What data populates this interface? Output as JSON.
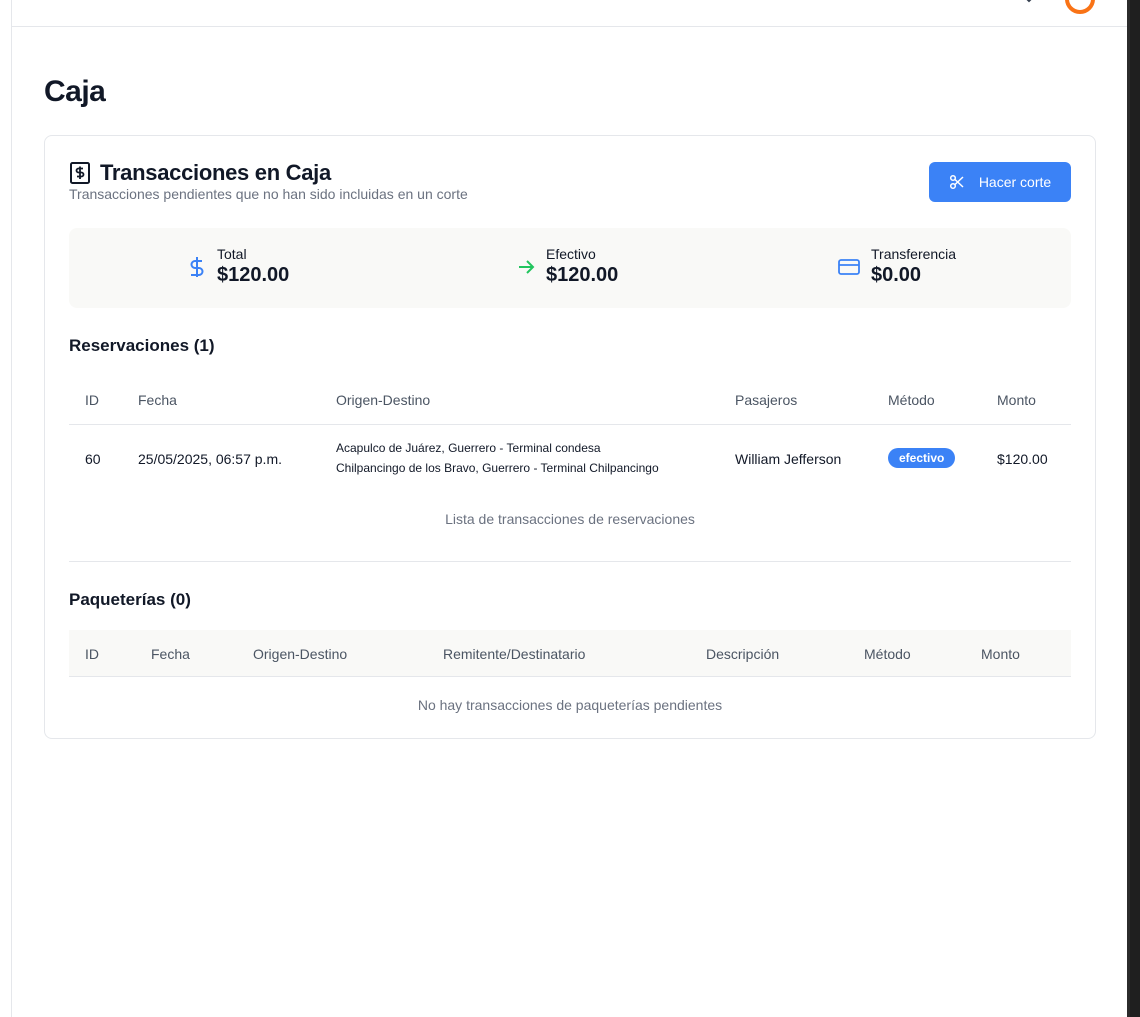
{
  "page": {
    "title": "Caja"
  },
  "card": {
    "title": "Transacciones en Caja",
    "subtitle": "Transacciones pendientes que no han sido incluidas en un corte",
    "button_label": "Hacer corte"
  },
  "summary": {
    "total": {
      "label": "Total",
      "value": "$120.00",
      "icon": "dollar-icon"
    },
    "cash": {
      "label": "Efectivo",
      "value": "$120.00",
      "icon": "arrow-right-icon"
    },
    "transfer": {
      "label": "Transferencia",
      "value": "$0.00",
      "icon": "credit-card-icon"
    }
  },
  "reservations": {
    "title": "Reservaciones (1)",
    "columns": [
      "ID",
      "Fecha",
      "Origen-Destino",
      "Pasajeros",
      "Método",
      "Monto"
    ],
    "rows": [
      {
        "id": "60",
        "date": "25/05/2025, 06:57 p.m.",
        "origin": "Acapulco de Juárez, Guerrero - Terminal condesa",
        "destination": "Chilpancingo de los Bravo, Guerrero - Terminal Chilpancingo",
        "passenger": "William Jefferson",
        "method": "efectivo",
        "amount": "$120.00"
      }
    ],
    "caption": "Lista de transacciones de reservaciones"
  },
  "packages": {
    "title": "Paqueterías (0)",
    "columns": [
      "ID",
      "Fecha",
      "Origen-Destino",
      "Remitente/Destinatario",
      "Descripción",
      "Método",
      "Monto"
    ],
    "empty": "No hay transacciones de paqueterías pendientes"
  },
  "colors": {
    "primary": "#3b82f6",
    "success": "#22c55e",
    "avatar_ring": "#f97316"
  }
}
